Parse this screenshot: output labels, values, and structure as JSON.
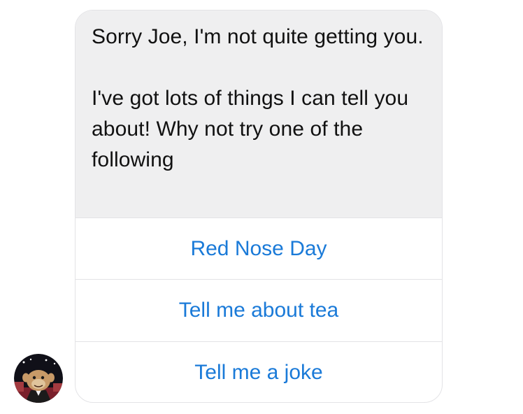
{
  "chat": {
    "message_paragraphs": [
      "Sorry Joe, I'm not quite getting you.",
      "I've got lots of things I can tell you about! Why not try one of the following"
    ],
    "quick_replies": [
      "Red Nose Day",
      "Tell me about tea",
      "Tell me a joke"
    ]
  },
  "avatar": {
    "icon": "monkey-avatar-icon"
  },
  "colors": {
    "bubble_background": "#efeff0",
    "reply_text": "#1a7ad8",
    "border": "#e3e3e6"
  }
}
